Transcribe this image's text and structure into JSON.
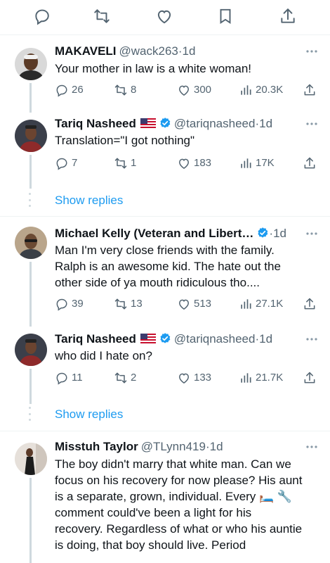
{
  "top_bar": {
    "icons": [
      "reply-icon",
      "retweet-icon",
      "like-icon",
      "bookmark-icon",
      "share-icon"
    ]
  },
  "posts": [
    {
      "name": "MAKAVELI",
      "handle": "@wack263",
      "time": "·1d",
      "text": "Your mother in law is a white woman!",
      "replies": "26",
      "retweets": "8",
      "likes": "300",
      "views": "20.3K"
    },
    {
      "name": "Tariq Nasheed",
      "flag": "🇺🇸",
      "handle": "@tariqnasheed",
      "time": "·1d",
      "text": "Translation=\"I got nothing\"",
      "replies": "7",
      "retweets": "1",
      "likes": "183",
      "views": "17K"
    },
    {
      "name": "Michael Kelly (Veteran and Libert…",
      "handle": "",
      "time": "·1d",
      "text": "Man I'm very close friends with the family.\nRalph is an awesome kid. The hate out the\nother side of ya mouth ridiculous tho....",
      "replies": "39",
      "retweets": "13",
      "likes": "513",
      "views": "27.1K"
    },
    {
      "name": "Tariq Nasheed",
      "flag": "🇺🇸",
      "handle": "@tariqnasheed",
      "time": "·1d",
      "text": "who did I hate on?",
      "replies": "11",
      "retweets": "2",
      "likes": "133",
      "views": "21.7K"
    },
    {
      "name": "Misstuh Taylor",
      "handle": "@TLynn419",
      "time": "·1d",
      "text": "The boy didn't marry that white man. Can we\nfocus on his recovery for now please? His aunt\nis a separate, grown, individual. Every 🛏️ 🔧\ncomment could've been a light for his\nrecovery. Regardless of what or who his auntie\nis doing, that boy should live. Period"
    }
  ],
  "show_replies_label": "Show replies",
  "colors": {
    "text": "#0f1419",
    "secondary": "#536471",
    "link": "#1d9bf0",
    "verified": "#1d9bf0",
    "divider": "#eff3f4",
    "thread_line": "#cfd9de"
  }
}
